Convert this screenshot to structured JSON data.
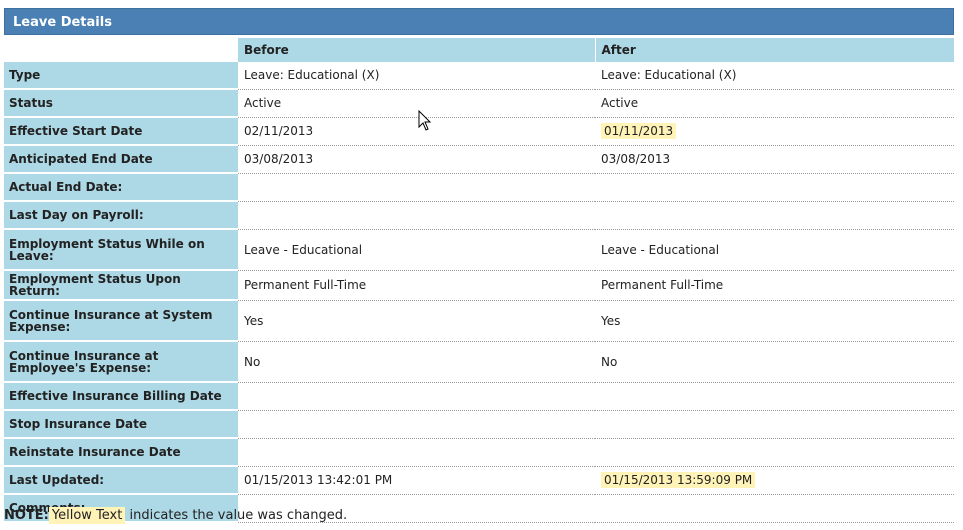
{
  "panel": {
    "title": "Leave Details"
  },
  "columns": {
    "before": "Before",
    "after": "After"
  },
  "rows": [
    {
      "label": "Type",
      "before": "Leave: Educational (X)",
      "after": "Leave: Educational (X)",
      "changed": false
    },
    {
      "label": "Status",
      "before": "Active",
      "after": "Active",
      "changed": false
    },
    {
      "label": "Effective Start Date",
      "before": "02/11/2013",
      "after": "01/11/2013",
      "changed": true
    },
    {
      "label": "Anticipated End Date",
      "before": "03/08/2013",
      "after": "03/08/2013",
      "changed": false
    },
    {
      "label": "Actual End Date:",
      "before": "",
      "after": "",
      "changed": false
    },
    {
      "label": "Last Day on Payroll:",
      "before": "",
      "after": "",
      "changed": false
    },
    {
      "label": "Employment Status While on Leave:",
      "before": "Leave - Educational",
      "after": "Leave - Educational",
      "changed": false
    },
    {
      "label": "Employment Status Upon Return:",
      "before": "Permanent Full-Time",
      "after": "Permanent Full-Time",
      "changed": false
    },
    {
      "label": "Continue Insurance at System Expense:",
      "before": "Yes",
      "after": "Yes",
      "changed": false
    },
    {
      "label": "Continue Insurance at Employee's Expense:",
      "before": "No",
      "after": "No",
      "changed": false
    },
    {
      "label": "Effective Insurance Billing Date",
      "before": "",
      "after": "",
      "changed": false
    },
    {
      "label": "Stop Insurance Date",
      "before": "",
      "after": "",
      "changed": false
    },
    {
      "label": "Reinstate Insurance Date",
      "before": "",
      "after": "",
      "changed": false
    },
    {
      "label": "Last Updated:",
      "before": "01/15/2013 13:42:01 PM",
      "after": "01/15/2013 13:59:09 PM",
      "changed": true
    },
    {
      "label": "Comments:",
      "before": "",
      "after": "",
      "changed": false
    }
  ],
  "note": {
    "prefix": "NOTE:",
    "highlight": "Yellow Text",
    "suffix": "indicates the value was changed."
  },
  "colors": {
    "header_bg": "#4a80b4",
    "label_bg": "#add8e6",
    "changed_bg": "#fff3b8"
  }
}
